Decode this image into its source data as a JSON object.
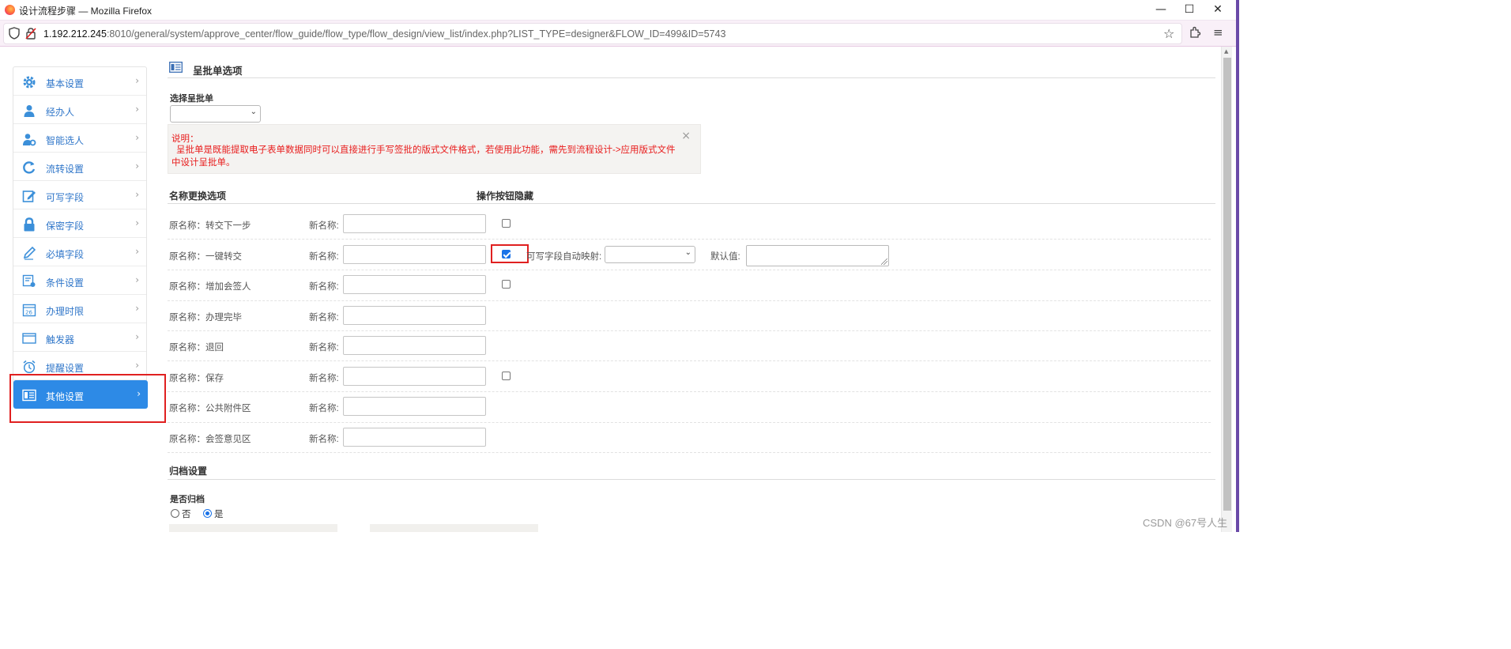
{
  "window": {
    "title": "设计流程步骤 — Mozilla Firefox",
    "minimize": "—",
    "maximize": "☐",
    "close": "✕"
  },
  "address_bar": {
    "host": "1.192.212.245",
    "rest": ":8010/general/system/approve_center/flow_guide/flow_type/flow_design/view_list/index.php?LIST_TYPE=designer&FLOW_ID=499&ID=5743"
  },
  "sidebar": {
    "items": [
      {
        "label": "基本设置",
        "icon": "gear-icon"
      },
      {
        "label": "经办人",
        "icon": "user-icon"
      },
      {
        "label": "智能选人",
        "icon": "user-gear-icon"
      },
      {
        "label": "流转设置",
        "icon": "refresh-icon"
      },
      {
        "label": "可写字段",
        "icon": "edit-icon"
      },
      {
        "label": "保密字段",
        "icon": "lock-icon"
      },
      {
        "label": "必填字段",
        "icon": "pencil-icon"
      },
      {
        "label": "条件设置",
        "icon": "condition-icon"
      },
      {
        "label": "办理时限",
        "icon": "calendar-icon"
      },
      {
        "label": "触发器",
        "icon": "window-icon"
      },
      {
        "label": "提醒设置",
        "icon": "alarm-icon"
      },
      {
        "label": "其他设置",
        "icon": "list-card-icon"
      }
    ],
    "active_index": 11,
    "chevron": "›"
  },
  "form_section": {
    "title": "呈批单选项",
    "select_label": "选择呈批单",
    "select_value": ""
  },
  "notice": {
    "title": "说明：",
    "body": "呈批单是既能提取电子表单数据同时可以直接进行手写签批的版式文件格式，若使用此功能，需先到流程设计->应用版式文件中设计呈批单。",
    "close": "×"
  },
  "rename": {
    "heading": "名称更换选项",
    "hide_heading": "操作按钮隐藏",
    "new_name_label": "新名称:",
    "rows": [
      {
        "original": "原名称：转交下一步",
        "new_value": "",
        "has_checkbox": true,
        "checked": false
      },
      {
        "original": "原名称：一键转交",
        "new_value": "",
        "has_checkbox": true,
        "checked": true
      },
      {
        "original": "原名称：增加会签人",
        "new_value": "",
        "has_checkbox": true,
        "checked": false
      },
      {
        "original": "原名称：办理完毕",
        "new_value": "",
        "has_checkbox": false,
        "checked": false
      },
      {
        "original": "原名称：退回",
        "new_value": "",
        "has_checkbox": false,
        "checked": false
      },
      {
        "original": "原名称：保存",
        "new_value": "",
        "has_checkbox": true,
        "checked": false
      },
      {
        "original": "原名称：公共附件区",
        "new_value": "",
        "has_checkbox": false,
        "checked": false
      },
      {
        "original": "原名称：会签意见区",
        "new_value": "",
        "has_checkbox": false,
        "checked": false
      }
    ],
    "mapping_label": "可写字段自动映射:",
    "mapping_value": "",
    "default_label": "默认值:",
    "default_value": ""
  },
  "archive": {
    "title": "归档设置",
    "question": "是否归档",
    "options": [
      "否",
      "是"
    ],
    "selected": "是"
  },
  "watermark": "CSDN @67号人生",
  "colors": {
    "accent": "#2d8ae6",
    "highlight": "#e02020",
    "notice_text": "#e81d1d"
  }
}
